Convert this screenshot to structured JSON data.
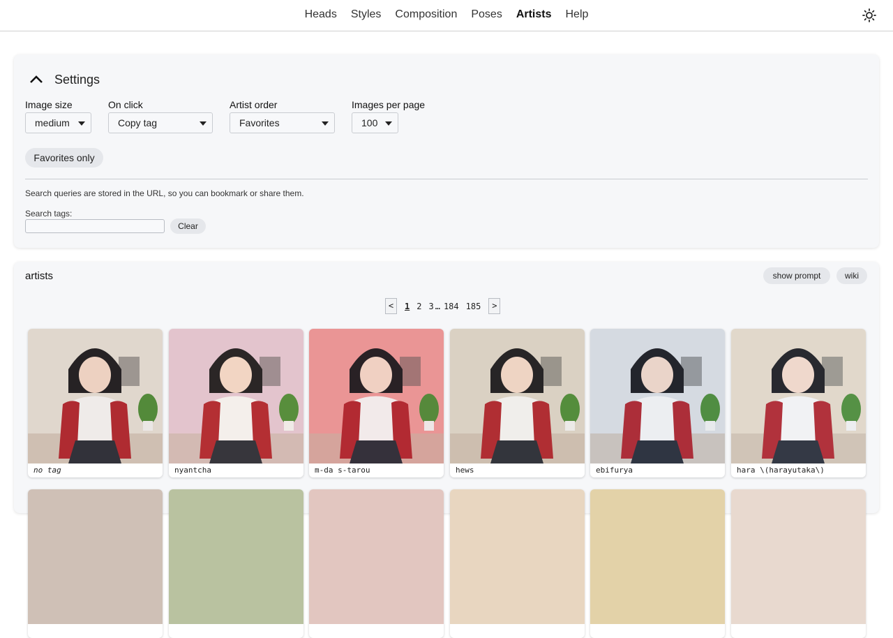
{
  "nav": {
    "links": [
      {
        "label": "Heads",
        "active": false
      },
      {
        "label": "Styles",
        "active": false
      },
      {
        "label": "Composition",
        "active": false
      },
      {
        "label": "Poses",
        "active": false
      },
      {
        "label": "Artists",
        "active": true
      },
      {
        "label": "Help",
        "active": false
      }
    ],
    "theme_icon": "sun-icon"
  },
  "settings": {
    "title": "Settings",
    "collapse_icon": "chevron-up-icon",
    "image_size": {
      "label": "Image size",
      "value": "medium"
    },
    "on_click": {
      "label": "On click",
      "value": "Copy tag"
    },
    "artist_order": {
      "label": "Artist order",
      "value": "Favorites"
    },
    "images_per_page": {
      "label": "Images per page",
      "value": "100"
    },
    "favorites_only": "Favorites only",
    "note": "Search queries are stored in the URL, so you can bookmark or share them.",
    "search_label": "Search tags:",
    "search_value": "",
    "clear": "Clear"
  },
  "artists": {
    "title": "artists",
    "show_prompt": "show prompt",
    "wiki": "wiki",
    "pagination": {
      "prev": "<",
      "pages": [
        "1",
        "2",
        "3"
      ],
      "ellipsis": "…",
      "tail": [
        "184",
        "185"
      ],
      "next": ">",
      "current": "1"
    },
    "tiles": [
      {
        "caption": "no tag",
        "notag": true,
        "wall": "#e8e2da",
        "accent": "#8b5a3c"
      },
      {
        "caption": "nyantcha",
        "notag": false,
        "wall": "#e5c9d7",
        "accent": "#d08a5a"
      },
      {
        "caption": "m-da s-tarou",
        "notag": false,
        "wall": "#ef9c9c",
        "accent": "#b24a4a"
      },
      {
        "caption": "hews",
        "notag": false,
        "wall": "#e0d8cc",
        "accent": "#9c7b55"
      },
      {
        "caption": "ebifurya",
        "notag": false,
        "wall": "#dfe2e6",
        "accent": "#6c7ea8"
      },
      {
        "caption": "hara \\(harayutaka\\)",
        "notag": false,
        "wall": "#e6dccb",
        "accent": "#a9b7c6"
      }
    ]
  }
}
